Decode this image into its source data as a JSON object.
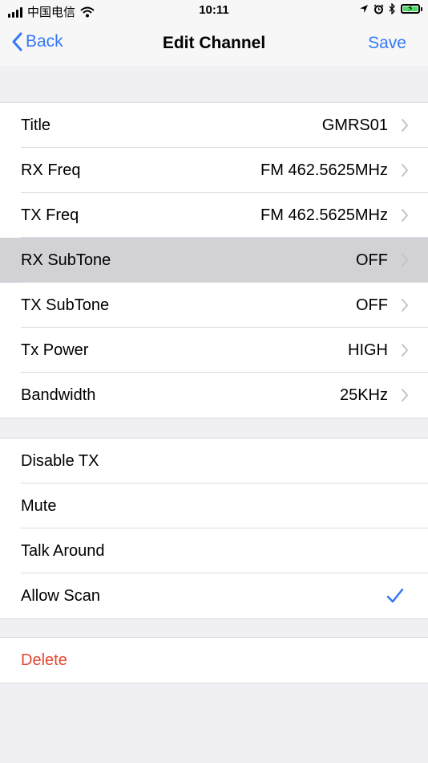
{
  "status_bar": {
    "carrier": "中国电信",
    "time": "10:11"
  },
  "nav": {
    "back_label": "Back",
    "title": "Edit Channel",
    "save_label": "Save"
  },
  "settings": [
    {
      "label": "Title",
      "value": "GMRS01"
    },
    {
      "label": "RX Freq",
      "value": "FM 462.5625MHz"
    },
    {
      "label": "TX Freq",
      "value": "FM 462.5625MHz"
    },
    {
      "label": "RX SubTone",
      "value": "OFF"
    },
    {
      "label": "TX SubTone",
      "value": "OFF"
    },
    {
      "label": "Tx Power",
      "value": "HIGH"
    },
    {
      "label": "Bandwidth",
      "value": "25KHz"
    }
  ],
  "toggles": [
    {
      "label": "Disable TX",
      "checked": false
    },
    {
      "label": "Mute",
      "checked": false
    },
    {
      "label": "Talk Around",
      "checked": false
    },
    {
      "label": "Allow Scan",
      "checked": true
    }
  ],
  "delete_label": "Delete",
  "colors": {
    "accent": "#3478f6",
    "destructive": "#e64632",
    "background": "#efeff4",
    "highlight_row": "#d1d1d6"
  }
}
